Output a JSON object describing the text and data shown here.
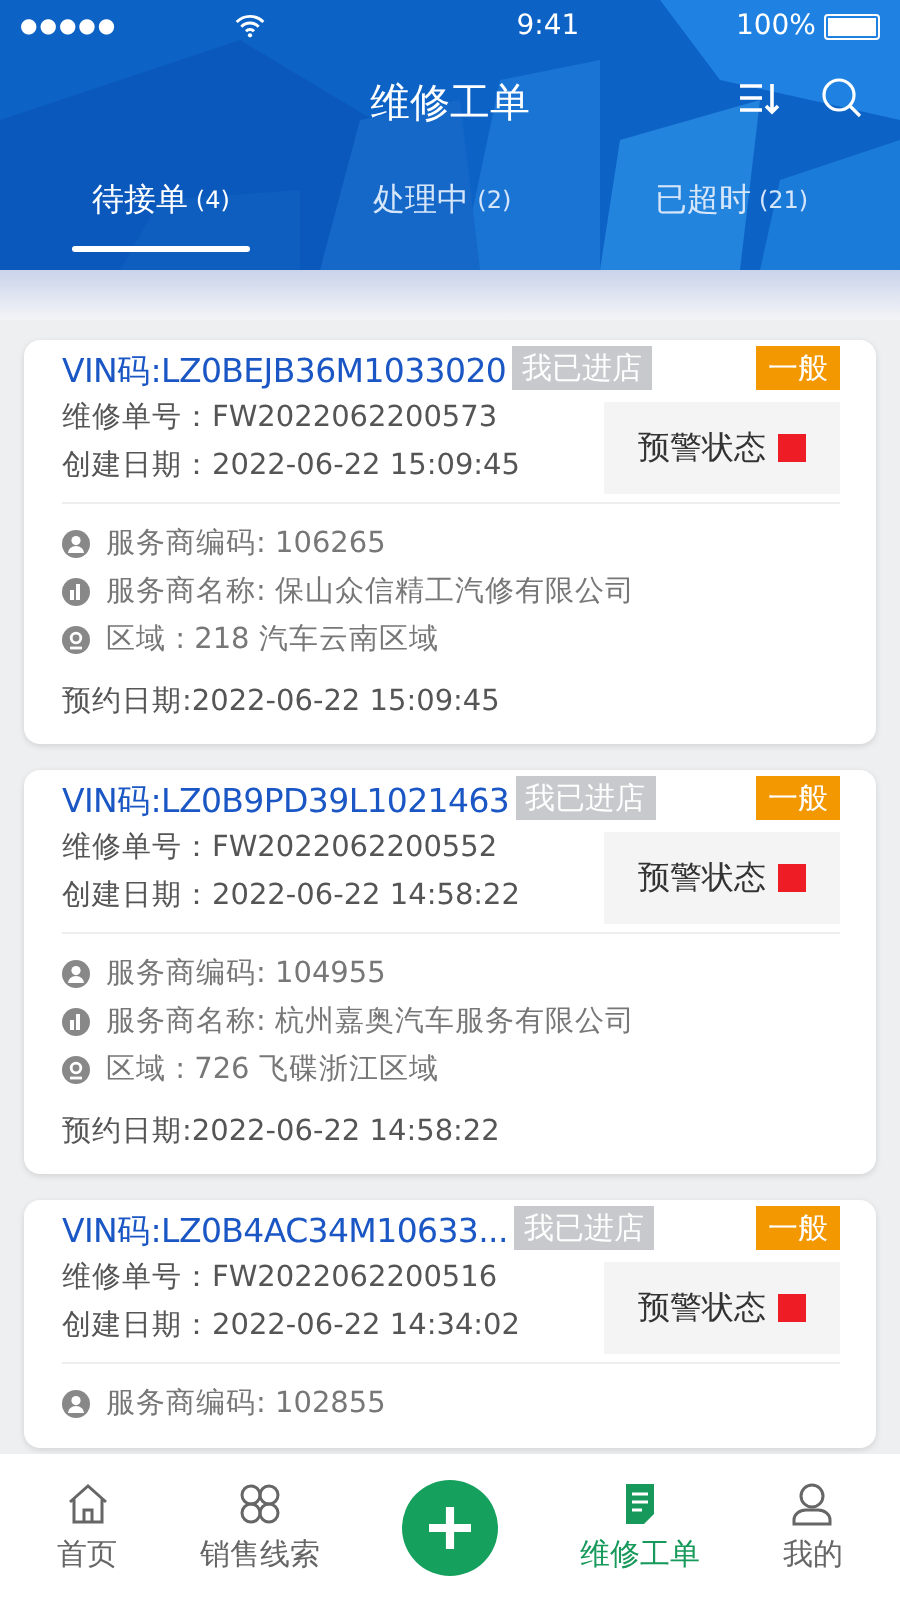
{
  "status_bar": {
    "signal_dots": "●●●●●",
    "time": "9:41",
    "battery": "100%"
  },
  "title": "维修工单",
  "tabs": [
    {
      "label": "待接单",
      "count": "(4)",
      "selected": true
    },
    {
      "label": "处理中",
      "count": "(2)",
      "selected": false
    },
    {
      "label": "已超时",
      "count": "(21)",
      "selected": false
    }
  ],
  "orders": [
    {
      "vin": "VIN码:LZ0BEJB36M1033020",
      "store_status": "我已进店",
      "priority": "一般",
      "alert_label": "预警状态",
      "repair_no": "维修单号：FW2022062200573",
      "created": "创建日期：2022-06-22 15:09:45",
      "provider_code": "服务商编码: 106265",
      "provider_name": "服务商名称: 保山众信精工汽修有限公司",
      "region": "区域 : 218 汽车云南区域",
      "appointment": "预约日期:2022-06-22 15:09:45"
    },
    {
      "vin": "VIN码:LZ0B9PD39L1021463",
      "store_status": "我已进店",
      "priority": "一般",
      "alert_label": "预警状态",
      "repair_no": "维修单号：FW2022062200552",
      "created": "创建日期：2022-06-22 14:58:22",
      "provider_code": "服务商编码: 104955",
      "provider_name": "服务商名称: 杭州嘉奥汽车服务有限公司",
      "region": "区域 : 726 飞碟浙江区域",
      "appointment": "预约日期:2022-06-22 14:58:22"
    },
    {
      "vin": "VIN码:LZ0B4AC34M10633...",
      "store_status": "我已进店",
      "priority": "一般",
      "alert_label": "预警状态",
      "repair_no": "维修单号：FW2022062200516",
      "created": "创建日期：2022-06-22 14:34:02",
      "provider_code": "服务商编码: 102855"
    }
  ],
  "nav": [
    {
      "kind": "home",
      "label": "首页",
      "selected": false
    },
    {
      "kind": "leads",
      "label": "销售线索",
      "selected": false
    },
    {
      "kind": "add"
    },
    {
      "kind": "orders",
      "label": "维修工单",
      "selected": true
    },
    {
      "kind": "me",
      "label": "我的",
      "selected": false
    }
  ]
}
